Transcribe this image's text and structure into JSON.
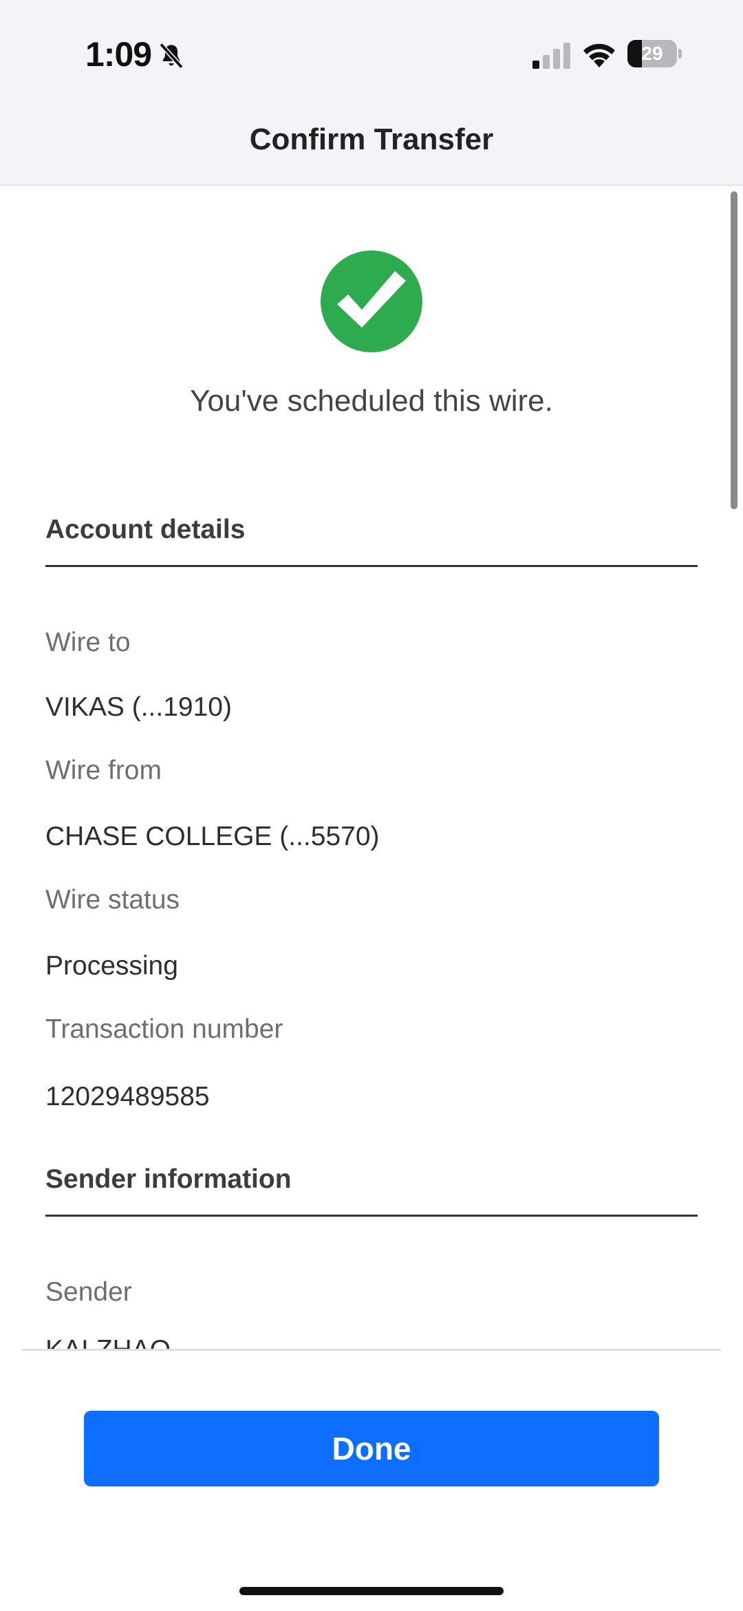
{
  "status_bar": {
    "time": "1:09",
    "battery_level": "29",
    "battery_fraction": 0.29,
    "silent_icon": "bell-slash-icon",
    "signal_icon": "cellular-signal-icon",
    "wifi_icon": "wifi-icon"
  },
  "header": {
    "title": "Confirm Transfer"
  },
  "confirmation": {
    "icon": "checkmark-circle-icon",
    "icon_color": "#2eab4f",
    "message": "You've scheduled this wire."
  },
  "account_details": {
    "heading": "Account details",
    "fields": [
      {
        "label": "Wire to",
        "value": "VIKAS (...1910)"
      },
      {
        "label": "Wire from",
        "value": "CHASE COLLEGE (...5570)"
      },
      {
        "label": "Wire status",
        "value": "Processing"
      },
      {
        "label": "Transaction number",
        "value": "12029489585"
      }
    ]
  },
  "sender_information": {
    "heading": "Sender information",
    "fields": [
      {
        "label": "Sender",
        "value": "KAI ZHAO"
      }
    ]
  },
  "footer": {
    "done_label": "Done",
    "button_color": "#0e6efd"
  }
}
